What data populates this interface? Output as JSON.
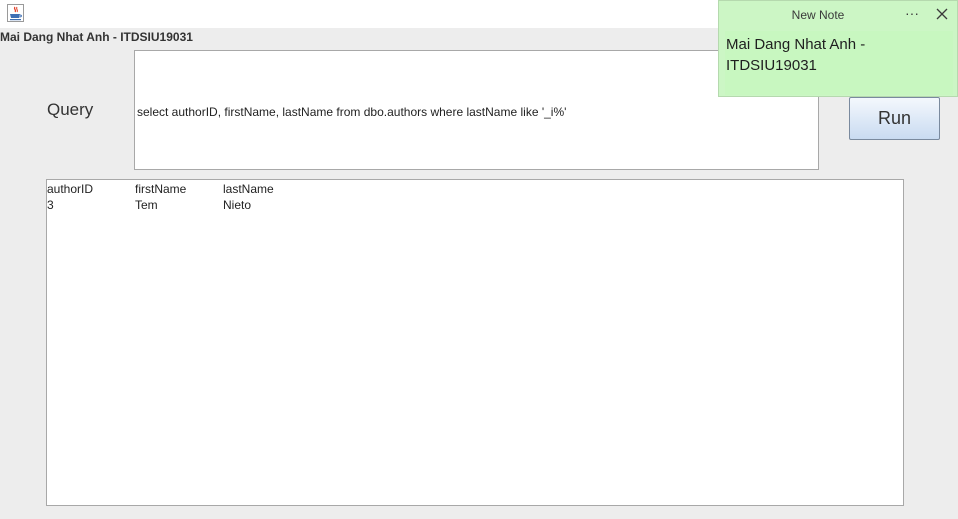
{
  "window": {
    "title": "Mai Dang Nhat Anh - ITDSIU19031",
    "app_icon": "java-cup-icon"
  },
  "query": {
    "label": "Query",
    "text": "select authorID, firstName, lastName from dbo.authors where lastName like '_i%'"
  },
  "run_button": {
    "label": "Run"
  },
  "results": {
    "columns": [
      "authorID",
      "firstName",
      "lastName"
    ],
    "rows": [
      [
        "3",
        "Tem",
        "Nieto"
      ]
    ]
  },
  "sticky_note": {
    "title": "New Note",
    "more_icon": "ellipsis-icon",
    "more_glyph": "···",
    "close_icon": "close-icon",
    "content": "Mai Dang Nhat Anh - ITDSIU19031",
    "background": "#ccf6c5"
  },
  "colors": {
    "window_bg": "#ededed",
    "button_gradient_top": "#f4f8fd",
    "button_gradient_bottom": "#c9dbf1"
  }
}
